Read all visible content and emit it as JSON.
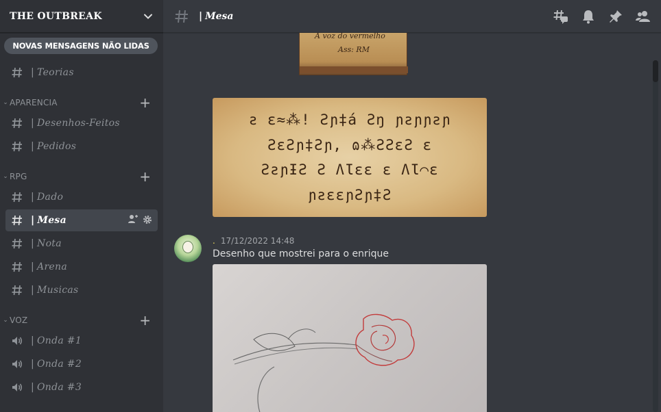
{
  "server": {
    "name": "THE OUTBREAK"
  },
  "banner": {
    "label": "NOVAS MENSAGENS NÃO LIDAS"
  },
  "channels": {
    "teorias": "Teorias",
    "cat_aparencia": "APARENCIA",
    "desenhos": "Desenhos-Feitos",
    "pedidos": "Pedidos",
    "cat_rpg": "RPG",
    "dado": "Dado",
    "mesa": "Mesa",
    "nota": "Nota",
    "arena": "Arena",
    "musicas": "Musicas",
    "cat_voz": "VOZ",
    "onda1": "Onda #1",
    "onda2": "Onda #2",
    "onda3": "Onda #3",
    "bar": "|"
  },
  "header": {
    "channel": "Mesa",
    "bar": "|"
  },
  "images": {
    "parchment_line1": "A voz do vermelho",
    "parchment_line2": "Ass: RM",
    "cipher_lines": [
      "ƨ ɛ≈⁂! Ƨɲ‡á Ƨŋ ɲƨɲɲƨɲ",
      "ƧɛƧɲ‡Ƨɲ, ɷ⁂ƧƧɛƧ ɛ",
      "ƧƨɲƗƧ Ƨ ɅƖɛɛ ɛ ɅƖ⌒ɛ",
      "ɲƨɛɛɲƧɲ‡Ƨ"
    ]
  },
  "message": {
    "username": ".",
    "timestamp": "17/12/2022 14:48",
    "text": "Desenho que mostrei para o enrique"
  },
  "colors": {
    "sidebar": "#2f3136",
    "main": "#36393f",
    "username": "#f2e15a"
  }
}
